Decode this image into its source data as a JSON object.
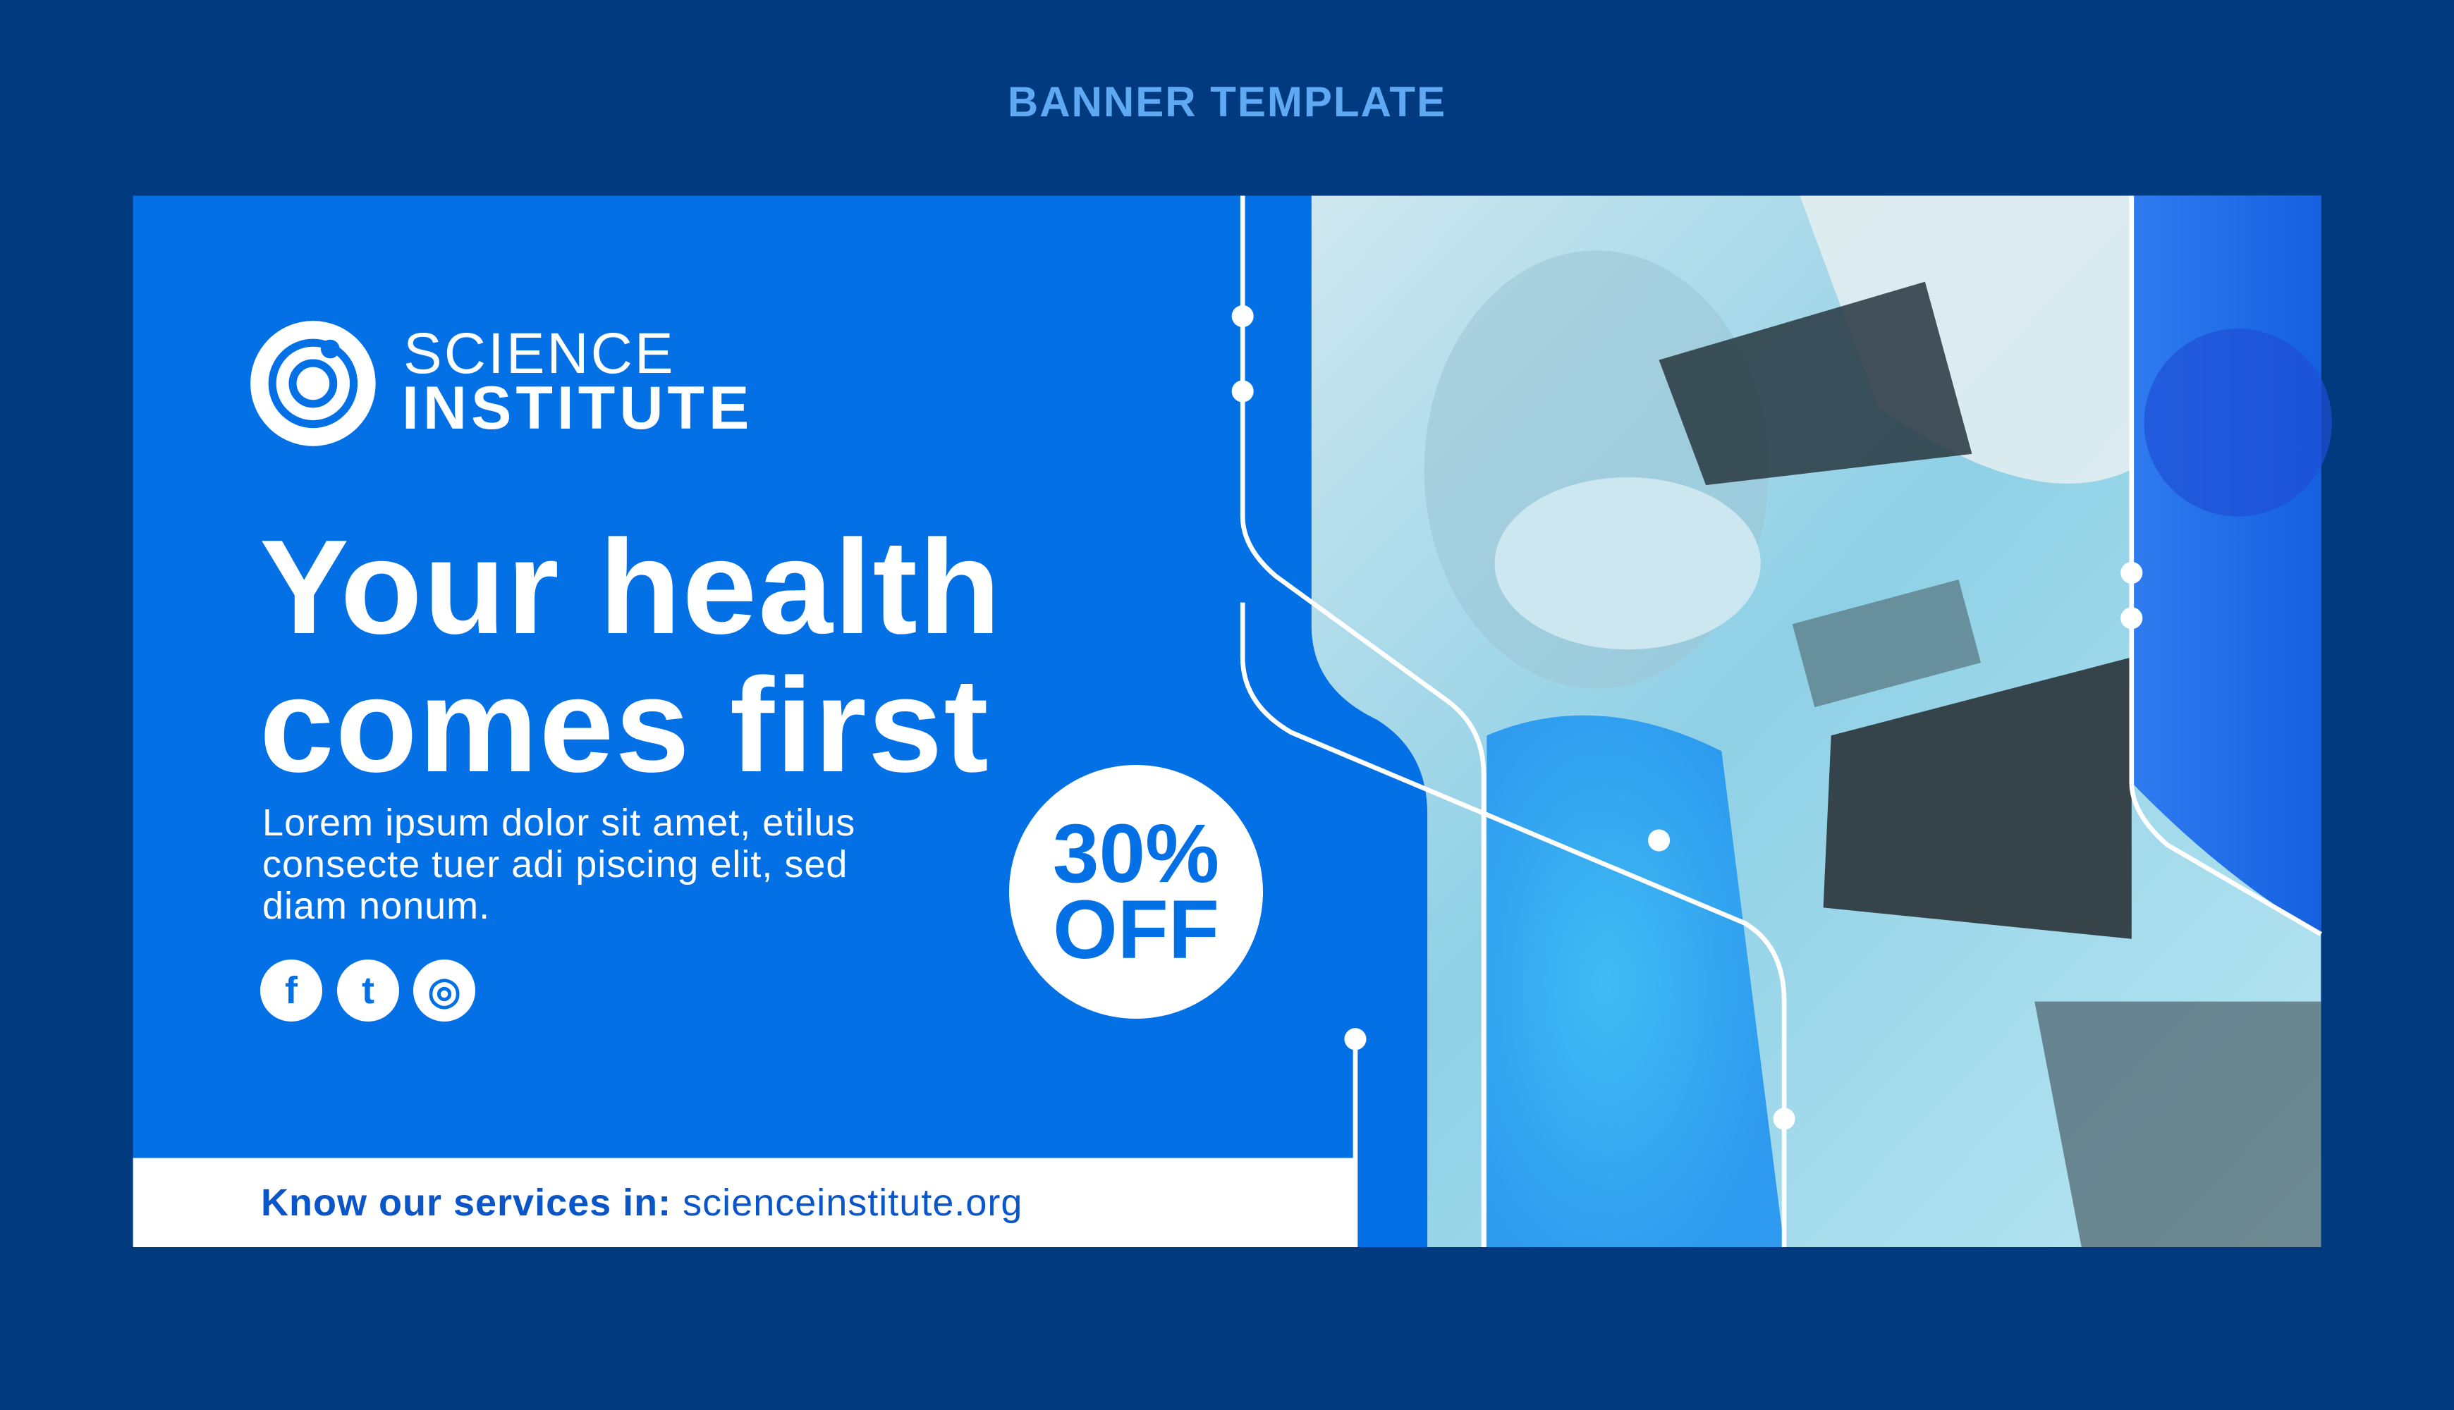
{
  "page_title": "BANNER TEMPLATE",
  "brand": {
    "line1": "SCIENCE",
    "line2": "INSTITUTE",
    "logo_icon": "atom-ring-icon"
  },
  "headline": {
    "line1": "Your health",
    "line2": "comes first"
  },
  "body_text": "Lorem ipsum dolor sit amet, etilus consecte tuer adi piscing elit, sed diam nonum.",
  "social": [
    {
      "name": "facebook",
      "glyph": "f"
    },
    {
      "name": "twitter",
      "glyph": "t"
    },
    {
      "name": "instagram",
      "glyph": "◎"
    }
  ],
  "badge": {
    "line1": "30%",
    "line2": "OFF"
  },
  "footer": {
    "label": "Know our services in:",
    "url": "scienceinstitute.org"
  },
  "colors": {
    "background": "#023a80",
    "banner_blue": "#0470e6",
    "title_blue": "#5ea9f2",
    "white": "#ffffff"
  }
}
